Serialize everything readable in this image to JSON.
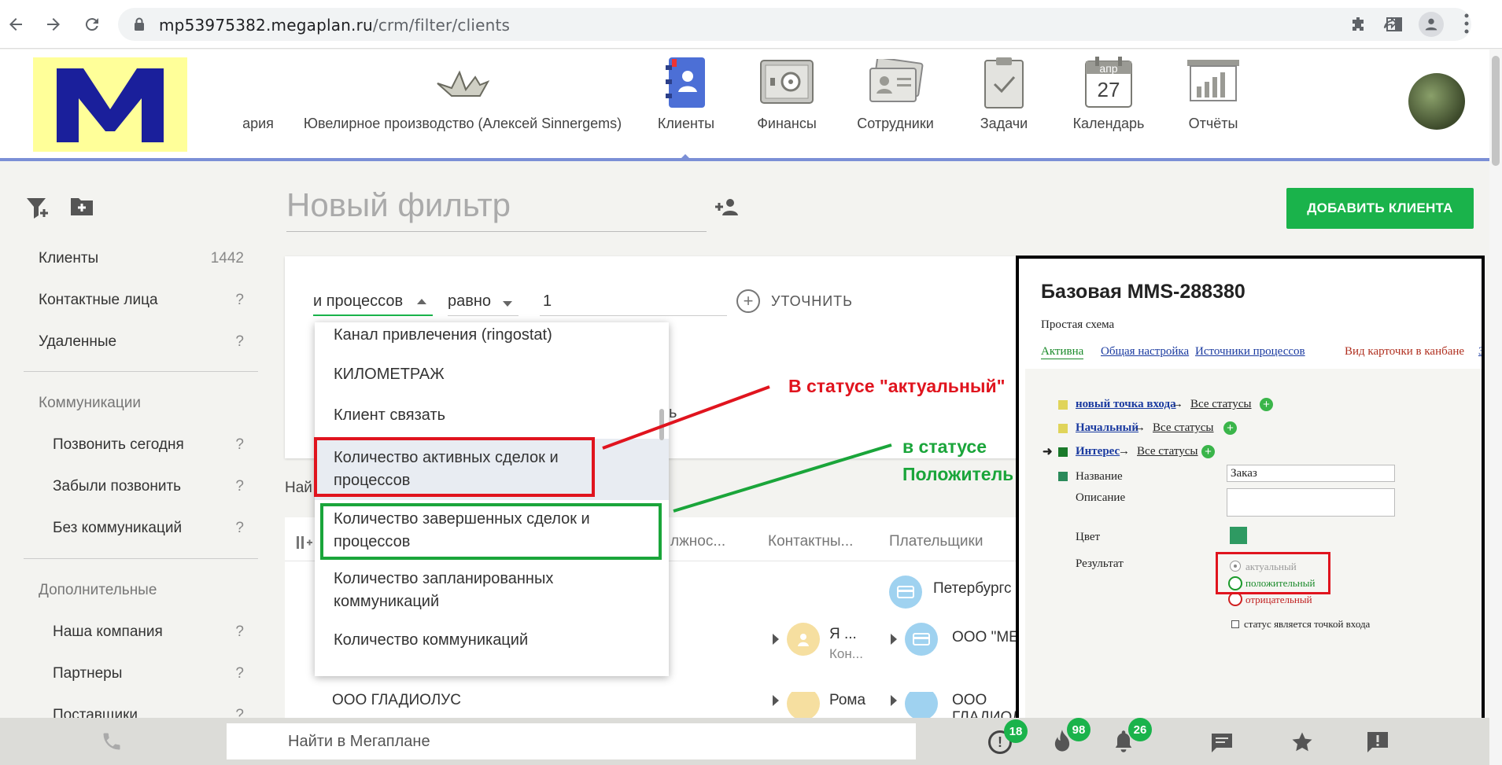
{
  "browser": {
    "url_host": "mp53975382.megaplan.ru",
    "url_path": "/crm/filter/clients"
  },
  "header": {
    "logo_letter": "M",
    "nav_items": [
      {
        "label": "ария",
        "icon": "crane-icon"
      },
      {
        "label": "Ювелирное производство (Алексей Sinnergems)",
        "icon": "origami-crane-icon"
      },
      {
        "label": "Клиенты",
        "icon": "contacts-book-icon",
        "active": true
      },
      {
        "label": "Финансы",
        "icon": "safe-icon"
      },
      {
        "label": "Сотрудники",
        "icon": "id-cards-icon"
      },
      {
        "label": "Задачи",
        "icon": "clipboard-check-icon"
      },
      {
        "label": "Календарь",
        "icon": "calendar-icon",
        "month": "апр",
        "day": "27"
      },
      {
        "label": "Отчёты",
        "icon": "bar-chart-icon"
      }
    ]
  },
  "sidebar": {
    "main_items": [
      {
        "label": "Клиенты",
        "count": "1442"
      },
      {
        "label": "Контактные лица",
        "count": "?"
      },
      {
        "label": "Удаленные",
        "count": "?"
      }
    ],
    "communications": {
      "heading": "Коммуникации",
      "items": [
        {
          "label": "Позвонить сегодня",
          "count": "?"
        },
        {
          "label": "Забыли позвонить",
          "count": "?"
        },
        {
          "label": "Без коммуникаций",
          "count": "?"
        }
      ]
    },
    "additional": {
      "heading": "Дополнительные",
      "items": [
        {
          "label": "Наша компания",
          "count": "?"
        },
        {
          "label": "Партнеры",
          "count": "?"
        },
        {
          "label": "Поставщики",
          "count": "?"
        }
      ]
    }
  },
  "main": {
    "filter_title": "Новый фильтр",
    "add_client_label": "ДОБАВИТЬ КЛИЕНТА",
    "condition": {
      "field": "и процессов",
      "operator": "равно",
      "value": "1",
      "refine_label": "УТОЧНИТЬ",
      "hidden_fragment": "ь"
    },
    "found_label": "Най",
    "table_headers": [
      "лжнос...",
      "Контактны...",
      "Плательщики"
    ],
    "rows": [
      {
        "payer": "Петербургс"
      },
      {
        "contact": "Я ...",
        "contact_sub": "Кон...",
        "payer": "ООО \"МЕ"
      },
      {
        "name": "ООО ГЛАДИОЛУС",
        "contact": "Рома",
        "payer": "ООО ГЛАДИОЛУС"
      }
    ]
  },
  "dropdown": {
    "options": [
      "Канал привлечения (ringostat)",
      "КИЛОМЕТРАЖ",
      "Клиент связать",
      "Количество активных сделок и процессов",
      "Количество завершенных сделок и процессов",
      "Количество запланированных коммуникаций",
      "Количество коммуникаций"
    ]
  },
  "annotations": {
    "red_text": "В статусе \"актуальный\"",
    "green_line1": "в статусе",
    "green_line2": "Положитель",
    "red_color": "#e0141e",
    "green_color": "#1aa53a"
  },
  "panel": {
    "title": "Базовая MMS-288380",
    "subtitle": "Простая схема",
    "tabs": [
      "Активна",
      "Общая настройка",
      "Источники процессов",
      "Вид карточки в канбане"
    ],
    "tab_overflow": "З",
    "statuses": [
      {
        "name": "новый точка входа",
        "arrow": "→",
        "target": "Все статусы"
      },
      {
        "name": "Начальный",
        "arrow": "→",
        "target": "Все статусы"
      },
      {
        "name": "Интерес",
        "arrow": "→",
        "target": "Все статусы"
      }
    ],
    "form": {
      "name_label": "Название",
      "name_value": "Заказ",
      "desc_label": "Описание",
      "color_label": "Цвет",
      "result_label": "Результат",
      "results": [
        "актуальный",
        "положительный",
        "отрицательный"
      ],
      "entry_checkbox": "статус является точкой входа"
    }
  },
  "bottom": {
    "search_placeholder": "Найти в Мегаплане",
    "badges": {
      "alerts": "18",
      "fire": "98",
      "bell": "26"
    }
  }
}
